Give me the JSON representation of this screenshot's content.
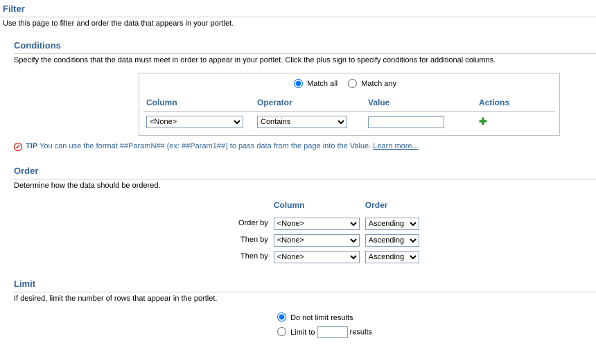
{
  "filter": {
    "title": "Filter",
    "desc": "Use this page to filter and order the data that appears in your portlet."
  },
  "conditions": {
    "title": "Conditions",
    "desc": "Specify the conditions that the data must meet in order to appear in your portlet. Click the plus sign to specify conditions for additional columns.",
    "match_all_label": "Match all",
    "match_any_label": "Match any",
    "headers": {
      "column": "Column",
      "operator": "Operator",
      "value": "Value",
      "actions": "Actions"
    },
    "row": {
      "column": "<None>",
      "operator": "Contains",
      "value": ""
    }
  },
  "tip": {
    "label": "TIP",
    "text": "You can use the format ##ParamN## (ex: ##Param1##) to pass data from the page into the Value.",
    "learn": "Learn more..."
  },
  "order": {
    "title": "Order",
    "desc": "Determine how the data should be ordered.",
    "headers": {
      "column": "Column",
      "order": "Order"
    },
    "rows": [
      {
        "label": "Order by",
        "column": "<None>",
        "dir": "Ascending"
      },
      {
        "label": "Then by",
        "column": "<None>",
        "dir": "Ascending"
      },
      {
        "label": "Then by",
        "column": "<None>",
        "dir": "Ascending"
      }
    ]
  },
  "limit": {
    "title": "Limit",
    "desc": "If desired, limit the number of rows that appear in the portlet.",
    "no_limit_label": "Do not limit results",
    "limit_to_label": "Limit to",
    "results_label": "results",
    "value": ""
  }
}
